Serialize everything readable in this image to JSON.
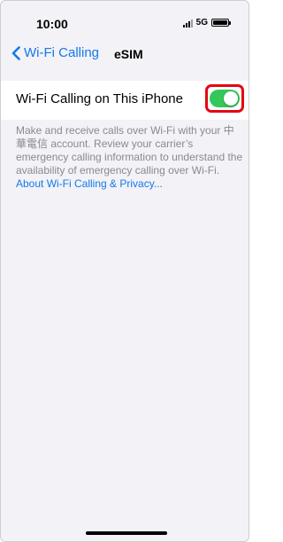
{
  "status_bar": {
    "time": "10:00",
    "network": "5G"
  },
  "nav": {
    "back_label": "Wi-Fi Calling",
    "title": "eSIM"
  },
  "setting": {
    "label": "Wi-Fi Calling on This iPhone",
    "toggle_on": true
  },
  "footer": {
    "description": "Make and receive calls over Wi-Fi with your 中華電信 account. Review your carrier’s emergency calling information to understand the availability of emergency calling over Wi-Fi. ",
    "link_text": "About Wi-Fi Calling & Privacy..."
  },
  "colors": {
    "accent": "#1479ea",
    "toggle_on": "#34c759",
    "highlight_box": "#e30613",
    "background": "#f2f2f7",
    "secondary_text": "#8a8a8e"
  },
  "icons": {
    "back": "chevron-left-icon",
    "signal": "cellular-signal-icon",
    "battery": "battery-icon"
  }
}
